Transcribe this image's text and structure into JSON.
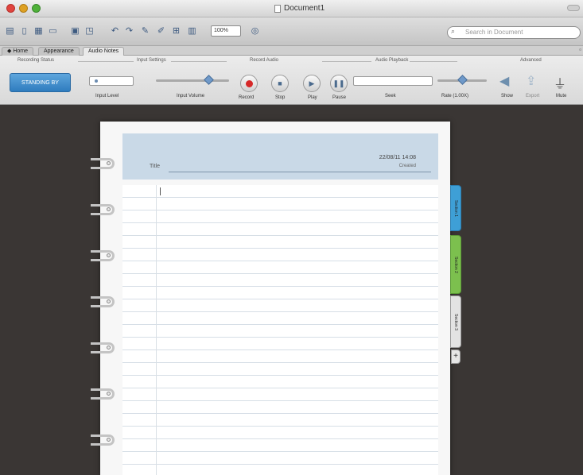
{
  "window": {
    "title": "Document1"
  },
  "toolbar": {
    "zoom": "100%",
    "search_placeholder": "Search in Document"
  },
  "tabs": [
    {
      "label": "Home"
    },
    {
      "label": "Appearance"
    },
    {
      "label": "Audio Notes"
    }
  ],
  "ribbon": {
    "groups": {
      "recording_status": "Recording Status",
      "input_settings": "Input Settings",
      "record_audio": "Record Audio",
      "audio_playback": "Audio Playback",
      "advanced": "Advanced"
    },
    "mode_button": "STANDING BY",
    "input_level": "Input Level",
    "input_volume": "Input Volume",
    "record": "Record",
    "stop": "Stop",
    "play": "Play",
    "pause": "Pause",
    "seek": "Seek",
    "rate": "Rate (1.00X)",
    "show": "Show",
    "export": "Export",
    "mute": "Mute"
  },
  "note": {
    "title_label": "Title",
    "date": "22/08/11 14:08",
    "created": "Created"
  },
  "sections": [
    {
      "label": "Section 1",
      "color": "#3e9fd6"
    },
    {
      "label": "Section 2",
      "color": "#7cc04e"
    },
    {
      "label": "Section 3",
      "color": "#e3e3e3"
    }
  ],
  "add_section_label": "+"
}
